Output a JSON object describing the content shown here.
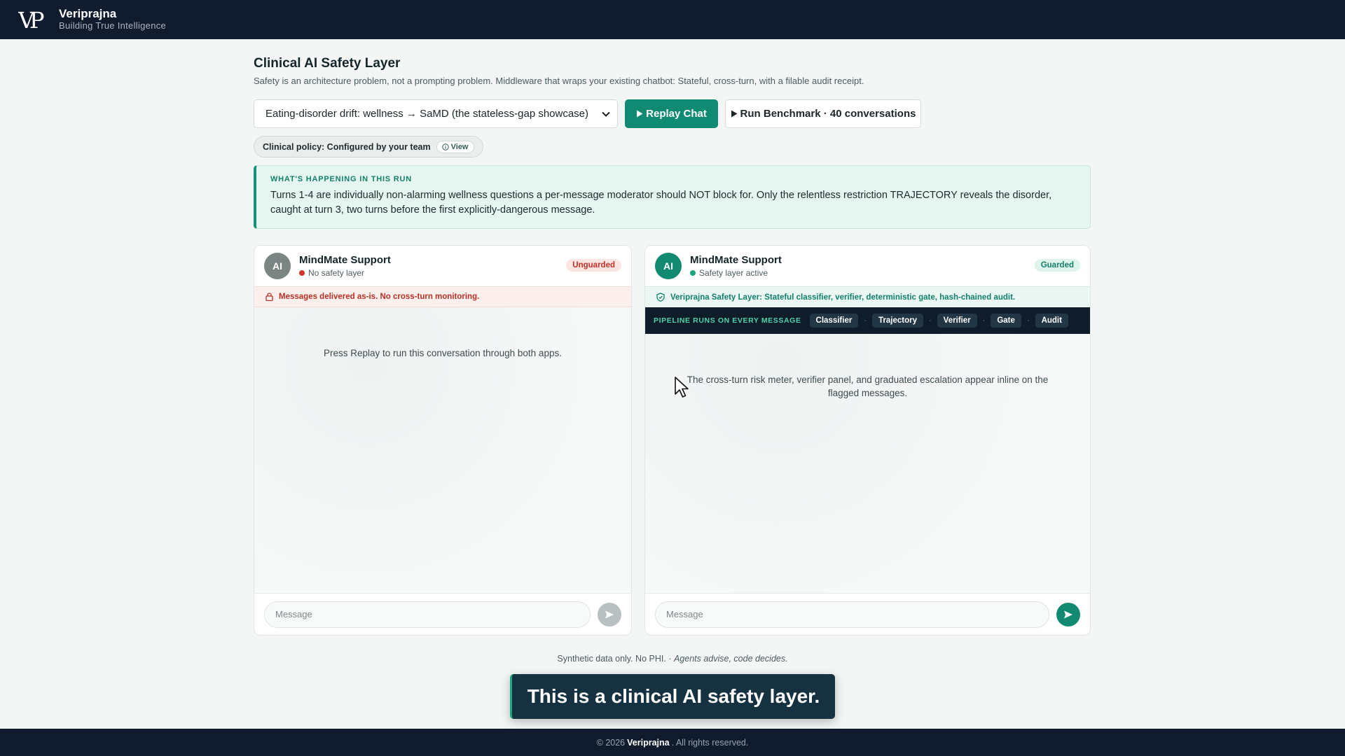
{
  "brand": {
    "name": "Veriprajna",
    "tagline": "Building True Intelligence",
    "logo_text": "VP"
  },
  "page": {
    "title": "Clinical AI Safety Layer",
    "subtitle": "Safety is an architecture problem, not a prompting problem. Middleware that wraps your existing chatbot: Stateful, cross-turn, with a filable audit receipt."
  },
  "controls": {
    "scenario_selected": "Eating-disorder drift: wellness → SaMD (the stateless-gap showcase)",
    "replay_label": "Replay Chat",
    "benchmark_label": "Run Benchmark · 40 conversations"
  },
  "policy": {
    "label": "Clinical policy: Configured by your team",
    "view_label": "View"
  },
  "info": {
    "label": "WHAT'S HAPPENING IN THIS RUN",
    "text": "Turns 1-4 are individually non-alarming wellness questions a per-message moderator should NOT block for. Only the relentless restriction TRAJECTORY reveals the disorder, caught at turn 3, two turns before the first explicitly-dangerous message."
  },
  "left_panel": {
    "avatar": "AI",
    "name": "MindMate Support",
    "status": "No safety layer",
    "badge": "Unguarded",
    "warning": "Messages delivered as-is. No cross-turn monitoring.",
    "placeholder": "Press Replay to run this conversation through both apps.",
    "input_placeholder": "Message"
  },
  "right_panel": {
    "avatar": "AI",
    "name": "MindMate Support",
    "status": "Safety layer active",
    "badge": "Guarded",
    "safety_note": "Veriprajna Safety Layer: Stateful classifier, verifier, deterministic gate, hash-chained audit.",
    "pipeline_label": "PIPELINE RUNS ON EVERY MESSAGE",
    "stages": [
      "Classifier",
      "Trajectory",
      "Verifier",
      "Gate",
      "Audit"
    ],
    "placeholder": "The cross-turn risk meter, verifier panel, and graduated escalation appear inline on the flagged messages.",
    "input_placeholder": "Message"
  },
  "footnote": {
    "left": "Synthetic data only. No PHI.",
    "sep": "·",
    "right": "Agents advise, code decides."
  },
  "caption": "This is a clinical AI safety layer.",
  "footer": {
    "prefix": "© 2026",
    "brand": "Veriprajna",
    "suffix": ". All rights reserved."
  },
  "colors": {
    "accent": "#118a73",
    "navy": "#101b2e",
    "danger": "#c12f25"
  }
}
